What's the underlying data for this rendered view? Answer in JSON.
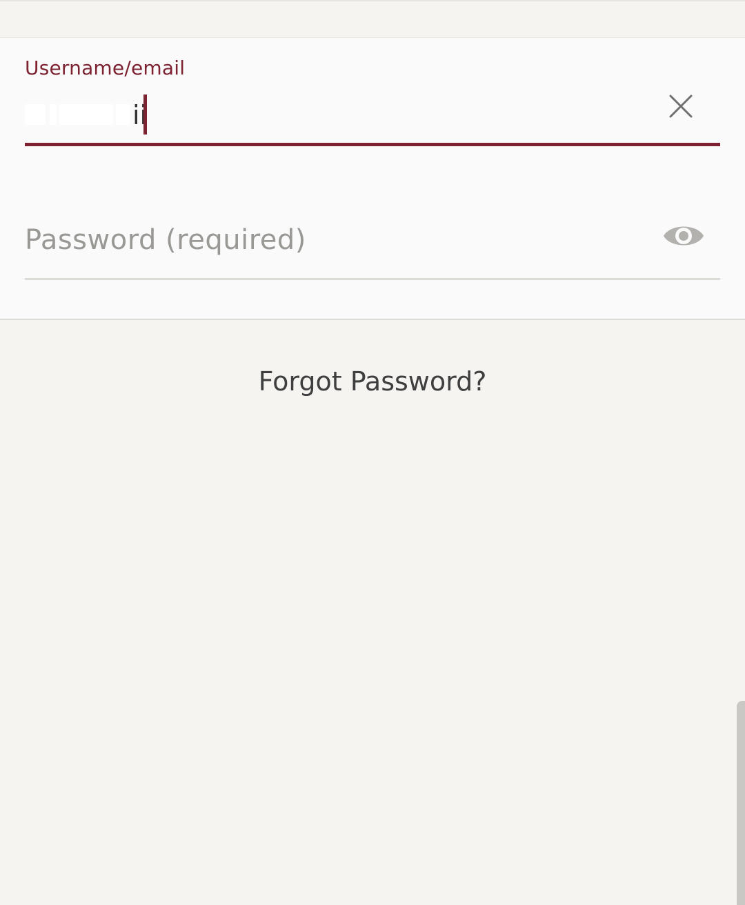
{
  "login_form": {
    "username": {
      "label": "Username/email",
      "value_visible": "ii",
      "clear_icon": "close-icon"
    },
    "password": {
      "placeholder": "Password (required)",
      "toggle_icon": "eye-icon"
    }
  },
  "links": {
    "forgot_password": "Forgot Password?"
  },
  "colors": {
    "accent": "#7d2231",
    "background": "#f5f4f1",
    "card": "#fafafa",
    "placeholder_text": "#9a9895"
  }
}
